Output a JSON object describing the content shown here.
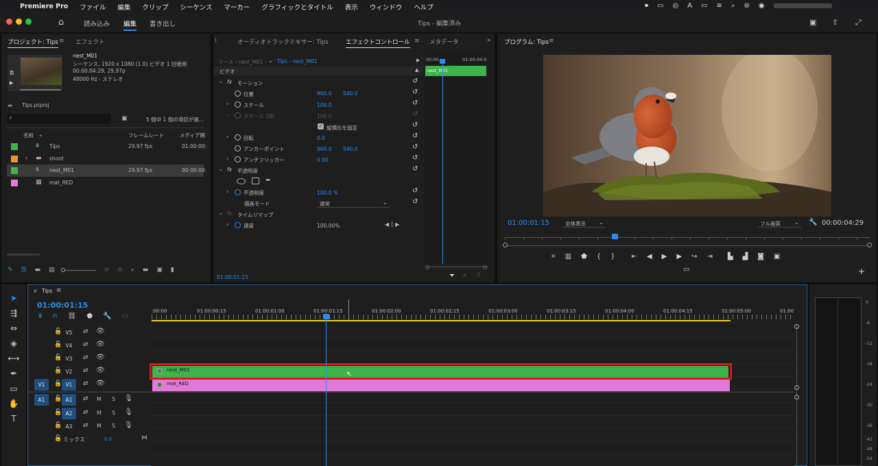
{
  "menubar": {
    "app": "Premiere Pro",
    "items": [
      "ファイル",
      "編集",
      "クリップ",
      "シーケンス",
      "マーカー",
      "グラフィックとタイトル",
      "表示",
      "ウィンドウ",
      "ヘルプ"
    ]
  },
  "workspace": {
    "tabs": [
      "読み込み",
      "編集",
      "書き出し"
    ],
    "title": "Tips - 編集済み"
  },
  "project": {
    "tabs": [
      "プロジェクト: Tips",
      "エフェクト"
    ],
    "preview": {
      "name": "nest_M01",
      "line1": "シーケンス, 1920 x 1080 (1.0)  ビデオ 1 回使用",
      "line2": "00:00:04:29, 29.97p",
      "line3": "48000 Hz - ステレオ"
    },
    "file": "Tips.prproj",
    "count": "5 個中 1 個の項目が選...",
    "columns": [
      "名前",
      "フレームレート",
      "メディア開"
    ],
    "items": [
      {
        "name": "Tips",
        "fps": "29.97 fps",
        "start": "01:00:00:",
        "color": "#3db54a",
        "icon": "sequence-icon"
      },
      {
        "name": "shoot",
        "fps": "",
        "start": "",
        "color": "#e8962e",
        "icon": "folder-icon"
      },
      {
        "name": "nest_M01",
        "fps": "29.97 fps",
        "start": "00:00:00:",
        "color": "#3db54a",
        "icon": "sequence-icon"
      },
      {
        "name": "mat_RED",
        "fps": "",
        "start": "",
        "color": "#e778dc",
        "icon": "matte-icon"
      }
    ]
  },
  "effects": {
    "tabs": [
      "オーディオトラックミキサー: Tips",
      "エフェクトコントロール",
      "メタデータ"
    ],
    "source": "ソース・nest_M01",
    "target": "Tips - nest_M01",
    "ruler": [
      "00:00",
      "01:00:04:0"
    ],
    "clip": "nest_M01",
    "section": "ビデオ",
    "motion": "モーション",
    "position": {
      "label": "位置",
      "x": "960.0",
      "y": "540.0"
    },
    "scale": {
      "label": "スケール",
      "value": "100.0"
    },
    "scale_w": {
      "label": "スケール (幅)",
      "value": "100.0"
    },
    "uniform": "縦横比を固定",
    "rotation": {
      "label": "回転",
      "value": "0.0"
    },
    "anchor": {
      "label": "アンカーポイント",
      "x": "960.0",
      "y": "540.0"
    },
    "flicker": {
      "label": "アンチフリッカー",
      "value": "0.00"
    },
    "opacity_sec": "不透明度",
    "opacity": {
      "label": "不透明度",
      "value": "100.0 %"
    },
    "blend": {
      "label": "描画モード",
      "value": "通常"
    },
    "timeremap": "タイムリマップ",
    "speed": {
      "label": "速度",
      "value": "100.00%"
    },
    "timecode": "01:00:01:15"
  },
  "program": {
    "title": "プログラム: Tips",
    "timecode": "01:00:01:15",
    "fit": "全体表示",
    "quality": "フル画質",
    "duration": "00:00:04:29",
    "playhead": 0.3
  },
  "timeline": {
    "tab": "Tips",
    "timecode": "01:00:01:15",
    "ruler": [
      ":00:00",
      "01:00:00:15",
      "01:00:01:00",
      "01:00:01:15",
      "01:00:02:00",
      "01:00:02:15",
      "01:00:03:00",
      "01:00:03:15",
      "01:00:04:00",
      "01:00:04:15",
      "01:00:05:00",
      "01:00"
    ],
    "vtracks": [
      {
        "name": "V5"
      },
      {
        "name": "V4"
      },
      {
        "name": "V3"
      },
      {
        "name": "V2"
      },
      {
        "name": "V1",
        "src": "V1"
      }
    ],
    "atracks": [
      {
        "name": "A1",
        "src": "A1"
      },
      {
        "name": "A2"
      },
      {
        "name": "A3"
      }
    ],
    "mix": {
      "label": "ミックス",
      "value": "0.0"
    },
    "m_label": "M",
    "s_label": "S",
    "clips": [
      {
        "name": "nest_M01",
        "color": "#3cb44b"
      },
      {
        "name": "mat_RED",
        "color": "#e07ad8"
      }
    ]
  },
  "meter": {
    "ticks": [
      "0",
      "-6",
      "-12",
      "-18",
      "-24",
      "-30",
      "-36",
      "-42",
      "-48",
      "-54"
    ]
  },
  "colors": {
    "accent": "#2d8ceb",
    "highlight": "#e0141e"
  }
}
